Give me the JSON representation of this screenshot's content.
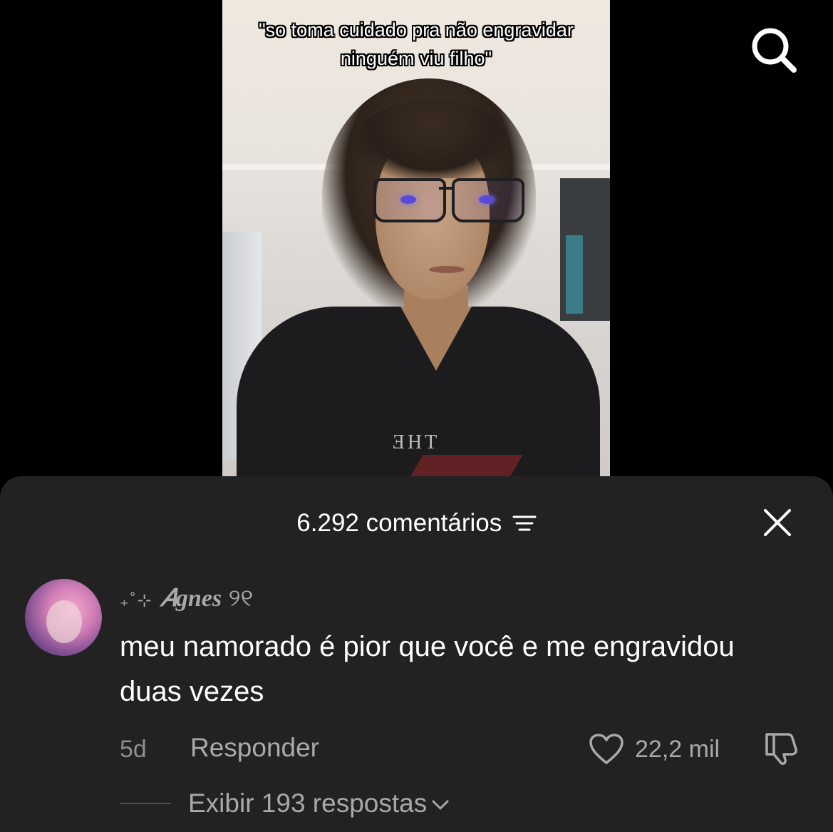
{
  "video": {
    "caption": "\"so toma cuidado pra não engravidar ninguém viu filho\"",
    "shirt_text": "ƎHT"
  },
  "comments_sheet": {
    "count_label": "6.292 comentários",
    "comment": {
      "username_prefix": "₊˚⊹",
      "username": "𝐴gnes",
      "username_suffix": "୨୧",
      "text": "meu namorado é pior que você e me engravidou duas vezes",
      "time": "5d",
      "reply_label": "Responder",
      "likes": "22,2 mil",
      "view_replies_label": "Exibir 193 respostas"
    }
  },
  "colors": {
    "sheet_bg": "#222223",
    "muted_text": "#a9a9ab"
  },
  "icons": [
    "search-icon",
    "sort-icon",
    "close-icon",
    "heart-icon",
    "dislike-icon",
    "chevron-down-icon"
  ]
}
